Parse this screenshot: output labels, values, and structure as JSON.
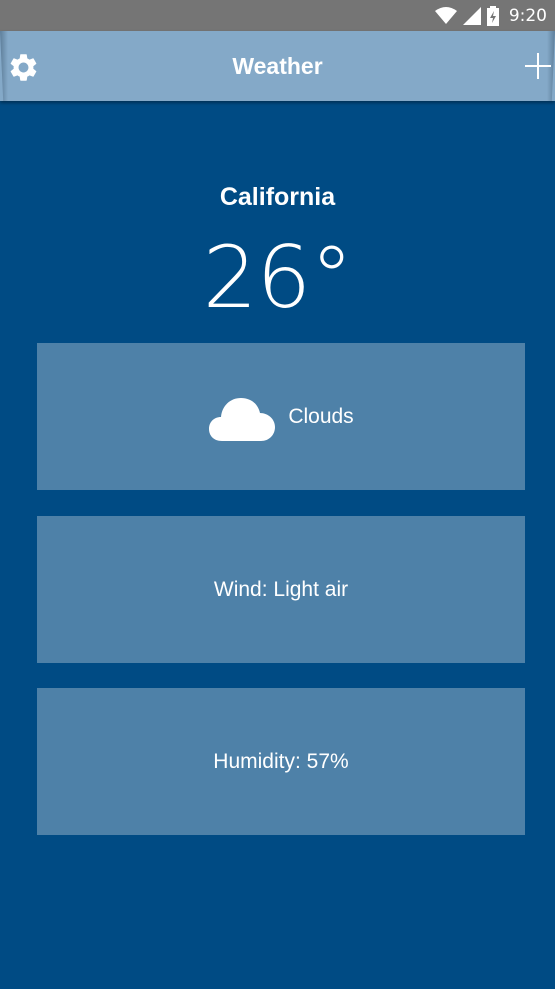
{
  "status_bar": {
    "time": "9:20",
    "icons": [
      "wifi-icon",
      "cell-signal-icon",
      "battery-icon"
    ]
  },
  "app_bar": {
    "title": "Weather",
    "left_icon": "gear-icon",
    "right_icon": "plus-icon"
  },
  "weather": {
    "location": "California",
    "temperature": "26°",
    "condition": "Clouds",
    "condition_icon": "cloud-icon",
    "wind": "Wind: Light air",
    "humidity": "Humidity: 57%"
  },
  "colors": {
    "background": "#004b84",
    "app_bar": "#84a9c8",
    "card": "#4e81a8",
    "status_bar": "#757575",
    "text": "#ffffff"
  }
}
